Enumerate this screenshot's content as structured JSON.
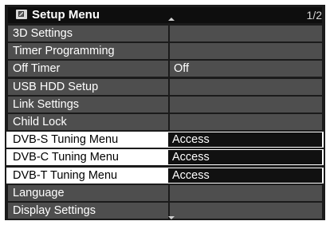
{
  "header": {
    "title": "Setup Menu",
    "page_indicator": "1/2",
    "icon": "setup-menu-icon"
  },
  "menu": {
    "items": [
      {
        "label": "3D Settings",
        "value": "",
        "highlighted": false
      },
      {
        "label": "Timer Programming",
        "value": "",
        "highlighted": false
      },
      {
        "label": "Off Timer",
        "value": "Off",
        "highlighted": false
      },
      {
        "label": "USB HDD Setup",
        "value": "",
        "highlighted": false
      },
      {
        "label": "Link Settings",
        "value": "",
        "highlighted": false
      },
      {
        "label": "Child Lock",
        "value": "",
        "highlighted": false
      },
      {
        "label": "DVB-S Tuning Menu",
        "value": "Access",
        "highlighted": true
      },
      {
        "label": "DVB-C Tuning Menu",
        "value": "Access",
        "highlighted": true
      },
      {
        "label": "DVB-T Tuning Menu",
        "value": "Access",
        "highlighted": true
      },
      {
        "label": "Language",
        "value": "",
        "highlighted": false
      },
      {
        "label": "Display Settings",
        "value": "",
        "highlighted": false
      }
    ]
  },
  "colors": {
    "panel_bg": "#1b1b1b",
    "row_bg": "#4e4e4e",
    "highlight_label_bg": "#ffffff",
    "highlight_value_bg": "#111111"
  }
}
